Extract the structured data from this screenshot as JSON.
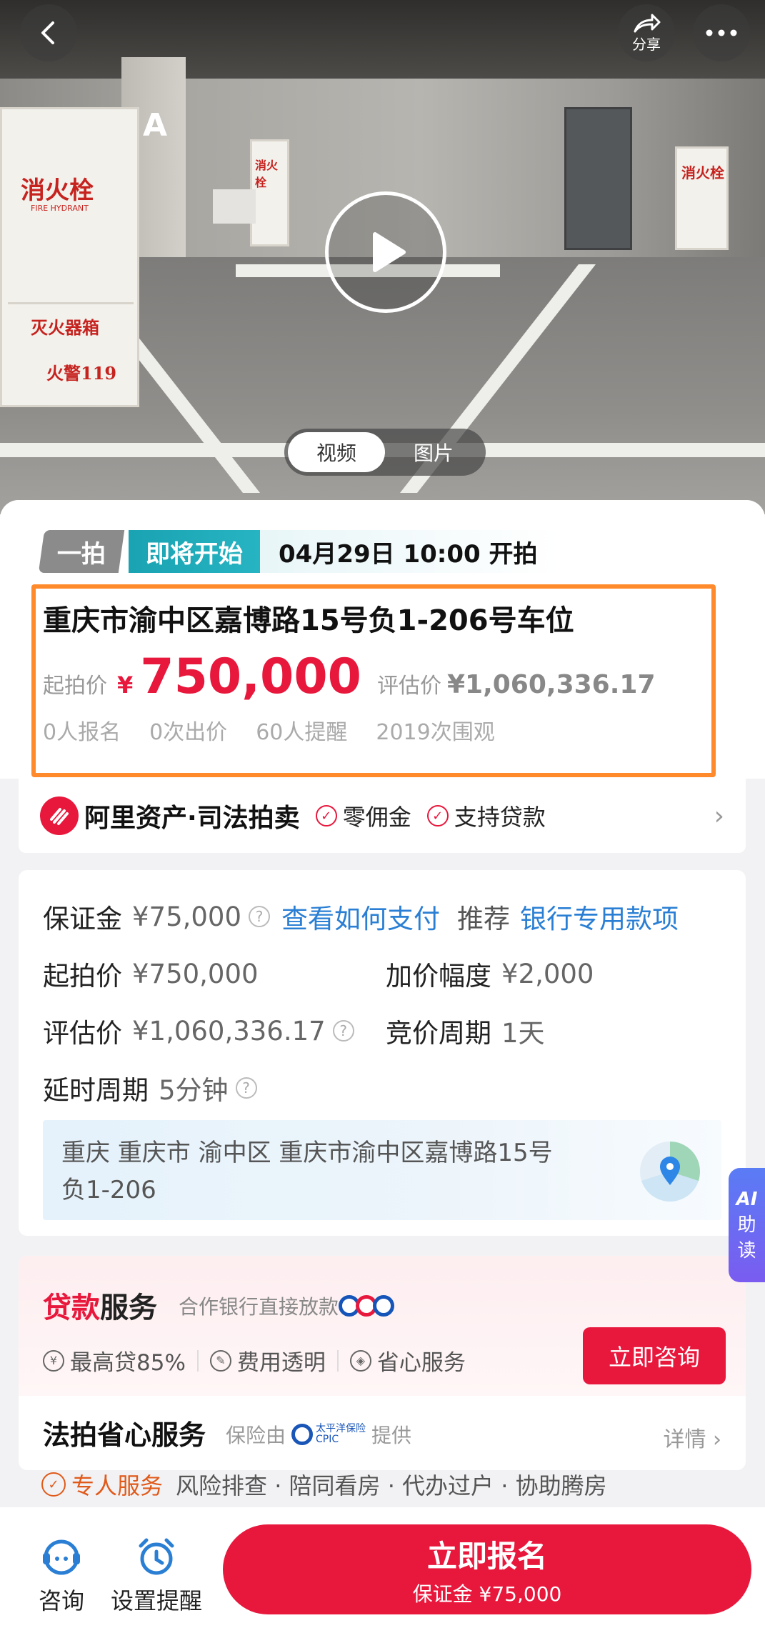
{
  "hero": {
    "share_label": "分享",
    "media_tabs": [
      "视频",
      "图片"
    ],
    "hydrant_left": {
      "title": "消火栓",
      "subtitle": "FIRE HYDRANT",
      "extinguisher": "灭火器箱",
      "alarm": "火警119"
    },
    "hydrant_mid": {
      "title": "消火栓"
    },
    "hydrant_right": {
      "title": "消火栓"
    },
    "pillar_letter": "A"
  },
  "status": {
    "auction_round": "一拍",
    "state": "即将开始",
    "start_time": "04月29日 10:00 开拍"
  },
  "lot": {
    "title": "重庆市渝中区嘉博路15号负1-206号车位",
    "start_price_label": "起拍价",
    "currency": "¥",
    "start_price": "750,000",
    "estimate_label": "评估价",
    "estimate_price": "¥1,060,336.17",
    "stats": [
      "0人报名",
      "0次出价",
      "60人提醒",
      "2019次围观"
    ]
  },
  "platform": {
    "name": "阿里资产·司法拍卖",
    "badges": [
      "零佣金",
      "支持贷款"
    ]
  },
  "details": {
    "deposit_label": "保证金",
    "deposit_value": "¥75,000",
    "how_to_pay": "查看如何支付",
    "recommend_label": "推荐",
    "recommend_link": "银行专用款项",
    "start_price_label": "起拍价",
    "start_price_value": "¥750,000",
    "increment_label": "加价幅度",
    "increment_value": "¥2,000",
    "estimate_label": "评估价",
    "estimate_value": "¥1,060,336.17",
    "cycle_label": "竞价周期",
    "cycle_value": "1天",
    "delay_label": "延时周期",
    "delay_value": "5分钟",
    "address_line1": "重庆 重庆市 渝中区 重庆市渝中区嘉博路15号",
    "address_line2": "负1-206"
  },
  "ai_tab": {
    "ai": "AI",
    "c1": "助",
    "c2": "读"
  },
  "loan": {
    "title_red": "贷款",
    "title_rest": "服务",
    "subtitle": "合作银行直接放款",
    "features": [
      "最高贷85%",
      "费用透明",
      "省心服务"
    ],
    "consult_button": "立即咨询"
  },
  "service": {
    "title": "法拍省心服务",
    "insured_by": "保险由",
    "insurer_cn": "太平洋保险",
    "insurer_en": "CPIC",
    "provided": "提供",
    "more": "详情",
    "highlight": "专人服务",
    "items": "风险排查 · 陪同看房 · 代办过户 · 协助腾房"
  },
  "bottom": {
    "consult": "咨询",
    "reminder": "设置提醒",
    "signup": "立即报名",
    "signup_sub": "保证金 ¥75,000"
  },
  "colors": {
    "accent_red": "#e8173c",
    "teal": "#1aa3b2",
    "highlight_orange": "#ff8a2b",
    "link_blue": "#2a7fd4"
  }
}
